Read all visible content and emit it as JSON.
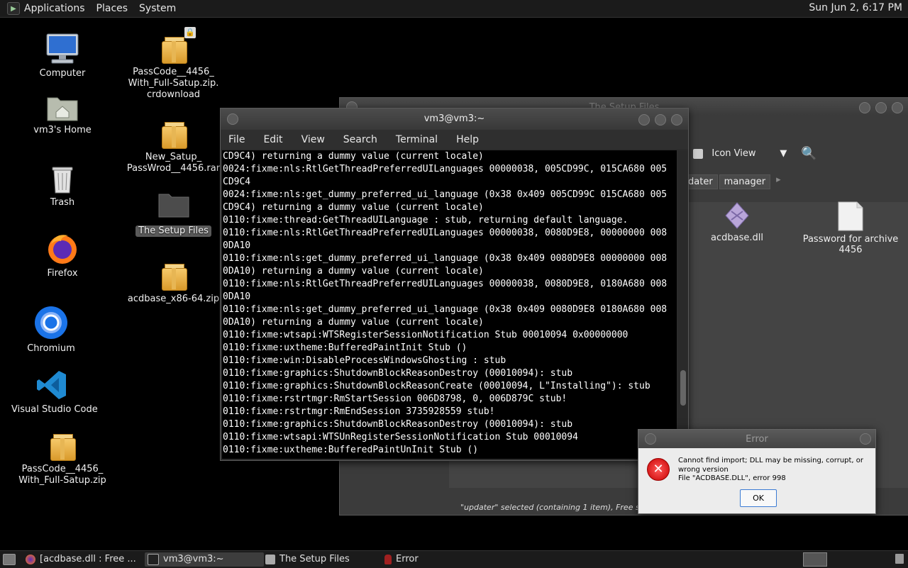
{
  "top_panel": {
    "menus": [
      "Applications",
      "Places",
      "System"
    ],
    "clock": "Sun Jun  2,  6:17 PM"
  },
  "desktop": {
    "icons_col1": [
      {
        "label": "Computer",
        "icon": "computer-icon"
      },
      {
        "label": "vm3's Home",
        "icon": "home-folder-icon"
      },
      {
        "label": "Trash",
        "icon": "trash-icon"
      },
      {
        "label": "Firefox",
        "icon": "firefox-icon"
      },
      {
        "label": "Chromium",
        "icon": "chromium-icon"
      },
      {
        "label": "Visual Studio Code",
        "icon": "vscode-icon"
      },
      {
        "label_lines": [
          "PassCode__4456_",
          "With_Full-Satup.zip"
        ],
        "icon": "archive-icon"
      }
    ],
    "icons_col2": [
      {
        "label_lines": [
          "PassCode__4456_",
          "With_Full-Satup.zip.",
          "crdownload"
        ],
        "icon": "archive-icon"
      },
      {
        "label_lines": [
          "New_Satup_",
          "PassWrod__4456.rar"
        ],
        "icon": "archive-icon"
      },
      {
        "label": "The Setup Files",
        "icon": "folder-icon"
      },
      {
        "label": "acdbase_x86-64.zip",
        "icon": "archive-icon"
      }
    ]
  },
  "setup_window": {
    "title": "The Setup Files",
    "toolbar": {
      "zoom_suffix": "%",
      "view_mode": "Icon View"
    },
    "path_buttons": [
      "dater",
      "manager"
    ],
    "files": [
      {
        "name": "acdbase.dll",
        "icon": "dll-file-icon"
      },
      {
        "name_lines": [
          "Password for archive",
          "4456"
        ],
        "icon": "text-file-icon"
      }
    ],
    "status": "\"updater\" selected (containing 1 item), Free space: 2"
  },
  "terminal": {
    "title": "vm3@vm3:~",
    "menu": [
      "File",
      "Edit",
      "View",
      "Search",
      "Terminal",
      "Help"
    ],
    "lines": [
      "CD9C4) returning a dummy value (current locale)",
      "0024:fixme:nls:RtlGetThreadPreferredUILanguages 00000038, 005CD99C, 015CA680 005",
      "CD9C4",
      "0024:fixme:nls:get_dummy_preferred_ui_language (0x38 0x409 005CD99C 015CA680 005",
      "CD9C4) returning a dummy value (current locale)",
      "0110:fixme:thread:GetThreadUILanguage : stub, returning default language.",
      "0110:fixme:nls:RtlGetThreadPreferredUILanguages 00000038, 0080D9E8, 00000000 008",
      "0DA10",
      "0110:fixme:nls:get_dummy_preferred_ui_language (0x38 0x409 0080D9E8 00000000 008",
      "0DA10) returning a dummy value (current locale)",
      "0110:fixme:nls:RtlGetThreadPreferredUILanguages 00000038, 0080D9E8, 0180A680 008",
      "0DA10",
      "0110:fixme:nls:get_dummy_preferred_ui_language (0x38 0x409 0080D9E8 0180A680 008",
      "0DA10) returning a dummy value (current locale)",
      "0110:fixme:wtsapi:WTSRegisterSessionNotification Stub 00010094 0x00000000",
      "0110:fixme:uxtheme:BufferedPaintInit Stub ()",
      "0110:fixme:win:DisableProcessWindowsGhosting : stub",
      "0110:fixme:graphics:ShutdownBlockReasonDestroy (00010094): stub",
      "0110:fixme:graphics:ShutdownBlockReasonCreate (00010094, L\"Installing\"): stub",
      "0110:fixme:rstrtmgr:RmStartSession 006D8798, 0, 006D879C stub!",
      "0110:fixme:rstrtmgr:RmEndSession 3735928559 stub!",
      "0110:fixme:graphics:ShutdownBlockReasonDestroy (00010094): stub",
      "0110:fixme:wtsapi:WTSUnRegisterSessionNotification Stub 00010094",
      "0110:fixme:uxtheme:BufferedPaintUnInit Stub ()"
    ]
  },
  "error_dialog": {
    "title": "Error",
    "message_lines": [
      "Cannot find import; DLL may be missing, corrupt, or",
      "wrong version",
      "File \"ACDBASE.DLL\", error 998"
    ],
    "ok_label": "OK"
  },
  "taskbar": {
    "tasks": [
      {
        "label": "[acdbase.dll : Free ...",
        "icon": "firefox-icon"
      },
      {
        "label": "vm3@vm3:~",
        "icon": "terminal-icon"
      },
      {
        "label": "The Setup Files",
        "icon": "folder-icon"
      },
      {
        "label": "Error",
        "icon": "wine-icon"
      }
    ]
  }
}
